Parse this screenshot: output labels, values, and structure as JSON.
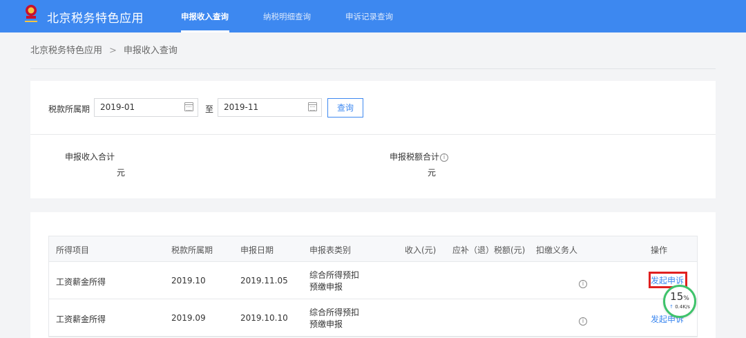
{
  "header": {
    "app_title": "北京税务特色应用",
    "nav": [
      {
        "label": "申报收入查询",
        "active": true
      },
      {
        "label": "纳税明细查询",
        "active": false
      },
      {
        "label": "申诉记录查询",
        "active": false
      }
    ],
    "brand_color": "#3d88f0"
  },
  "breadcrumb": {
    "root": "北京税务特色应用",
    "separator": ">",
    "current": "申报收入查询"
  },
  "query": {
    "period_label": "税款所属期",
    "start_date": "2019-01",
    "to_label": "至",
    "end_date": "2019-11",
    "search_button": "查询"
  },
  "summary": {
    "income_total_label": "申报收入合计",
    "income_total_unit": "元",
    "tax_total_label": "申报税额合计",
    "tax_total_unit": "元"
  },
  "table": {
    "headers": [
      "所得项目",
      "税款所属期",
      "申报日期",
      "申报表类别",
      "收入(元)",
      "应补（退）税额(元)",
      "扣缴义务人",
      "操作"
    ],
    "rows": [
      {
        "item": "工资薪金所得",
        "period": "2019.10",
        "date": "2019.11.05",
        "category_line1": "综合所得预扣",
        "category_line2": "预缴申报",
        "income": "",
        "tax": "",
        "withholder": "",
        "action": "发起申诉"
      },
      {
        "item": "工资薪金所得",
        "period": "2019.09",
        "date": "2019.10.10",
        "category_line1": "综合所得预扣",
        "category_line2": "预缴申报",
        "income": "",
        "tax": "",
        "withholder": "",
        "action": "发起申诉"
      }
    ]
  },
  "speed_widget": {
    "percent": "15",
    "percent_sign": "%",
    "rate": "0.4K/s",
    "arrow": "↑"
  }
}
